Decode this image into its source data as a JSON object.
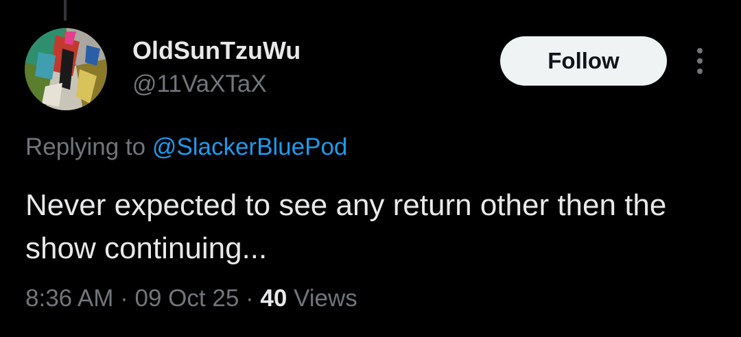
{
  "user": {
    "display_name": "OldSunTzuWu",
    "handle": "@11VaXTaX"
  },
  "actions": {
    "follow_label": "Follow",
    "more_icon": "more-vertical-icon"
  },
  "reply": {
    "prefix": "Replying to ",
    "mention": "@SlackerBluePod"
  },
  "tweet": {
    "text": "Never expected to see any return other then the show continuing..."
  },
  "meta": {
    "time": "8:36 AM",
    "separator": " · ",
    "date": "09 Oct 25",
    "views_count": "40",
    "views_label": " Views"
  },
  "colors": {
    "background": "#000000",
    "text_primary": "#e7e9ea",
    "text_secondary": "#71767b",
    "link": "#1d9bf0",
    "button_bg": "#eff3f4"
  }
}
